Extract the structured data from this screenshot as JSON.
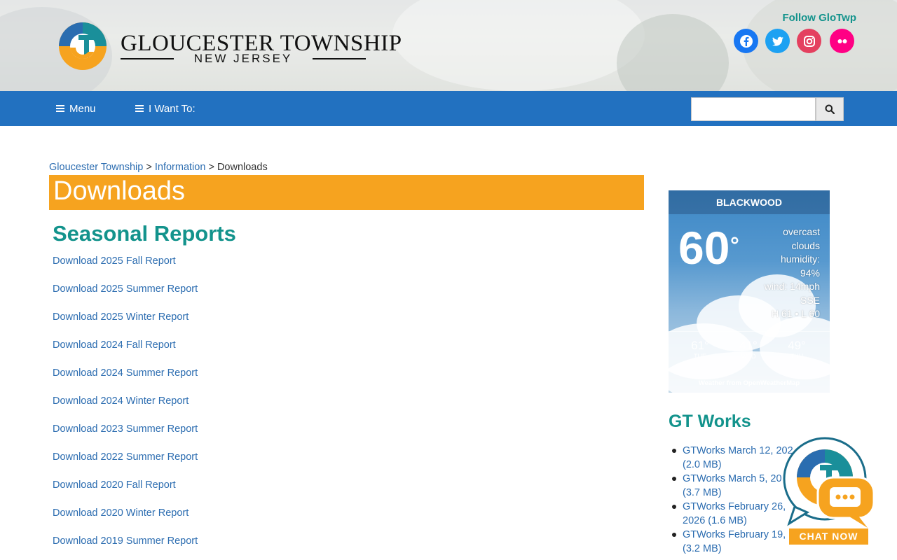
{
  "header": {
    "brand_name": "GLOUCESTER TOWNSHIP",
    "brand_sub": "NEW JERSEY",
    "follow_label": "Follow GloTwp",
    "social": [
      {
        "name": "facebook",
        "color": "#1877f2"
      },
      {
        "name": "twitter",
        "color": "#1da1f2"
      },
      {
        "name": "instagram",
        "color": "#e4405f"
      },
      {
        "name": "flickr",
        "color": "#ff0084"
      }
    ]
  },
  "nav": {
    "menu_label": "Menu",
    "iwant_label": "I Want To:",
    "search_placeholder": ""
  },
  "breadcrumb": {
    "home": "Gloucester Township",
    "sep1": " > ",
    "section": "Information",
    "sep2": " > ",
    "current": "Downloads"
  },
  "page": {
    "title": "Downloads",
    "section_heading": "Seasonal Reports",
    "downloads": [
      "Download 2025 Fall Report",
      "Download 2025 Summer Report",
      "Download 2025 Winter Report",
      "Download 2024 Fall Report",
      "Download 2024 Summer Report",
      "Download 2024 Winter Report",
      "Download 2023 Summer Report",
      "Download 2022 Summer Report",
      "Download 2020 Fall Report",
      "Download 2020 Winter Report",
      "Download 2019 Summer Report"
    ]
  },
  "weather": {
    "location": "BLACKWOOD",
    "temp": "60",
    "deg": "°",
    "desc_lines": [
      "overcast",
      "clouds",
      "humidity:",
      "94%",
      "wind: 14mph",
      "SSE",
      "H 61 • L 60"
    ],
    "forecast": [
      {
        "temp": "61°",
        "day": "TUE"
      },
      {
        "temp": "41°",
        "day": "WED"
      },
      {
        "temp": "49°",
        "day": "THU"
      }
    ],
    "credit": "Weather from OpenWeatherMap"
  },
  "sidebar": {
    "heading": "GT Works",
    "items": [
      {
        "line1": "GTWorks March 12, 202",
        "line2": "(2.0 MB)"
      },
      {
        "line1": "GTWorks March 5, 20",
        "line2": "(3.7 MB)"
      },
      {
        "line1": "GTWorks February 26,",
        "line2": "2026 (1.6 MB)"
      },
      {
        "line1": "GTWorks February 19,",
        "line2": "(3.2 MB)"
      }
    ]
  },
  "chat": {
    "label": "CHAT NOW"
  },
  "colors": {
    "nav_blue": "#2271c0",
    "title_orange": "#f6a31f",
    "heading_teal": "#13938c",
    "link_blue": "#2b6cb0"
  }
}
